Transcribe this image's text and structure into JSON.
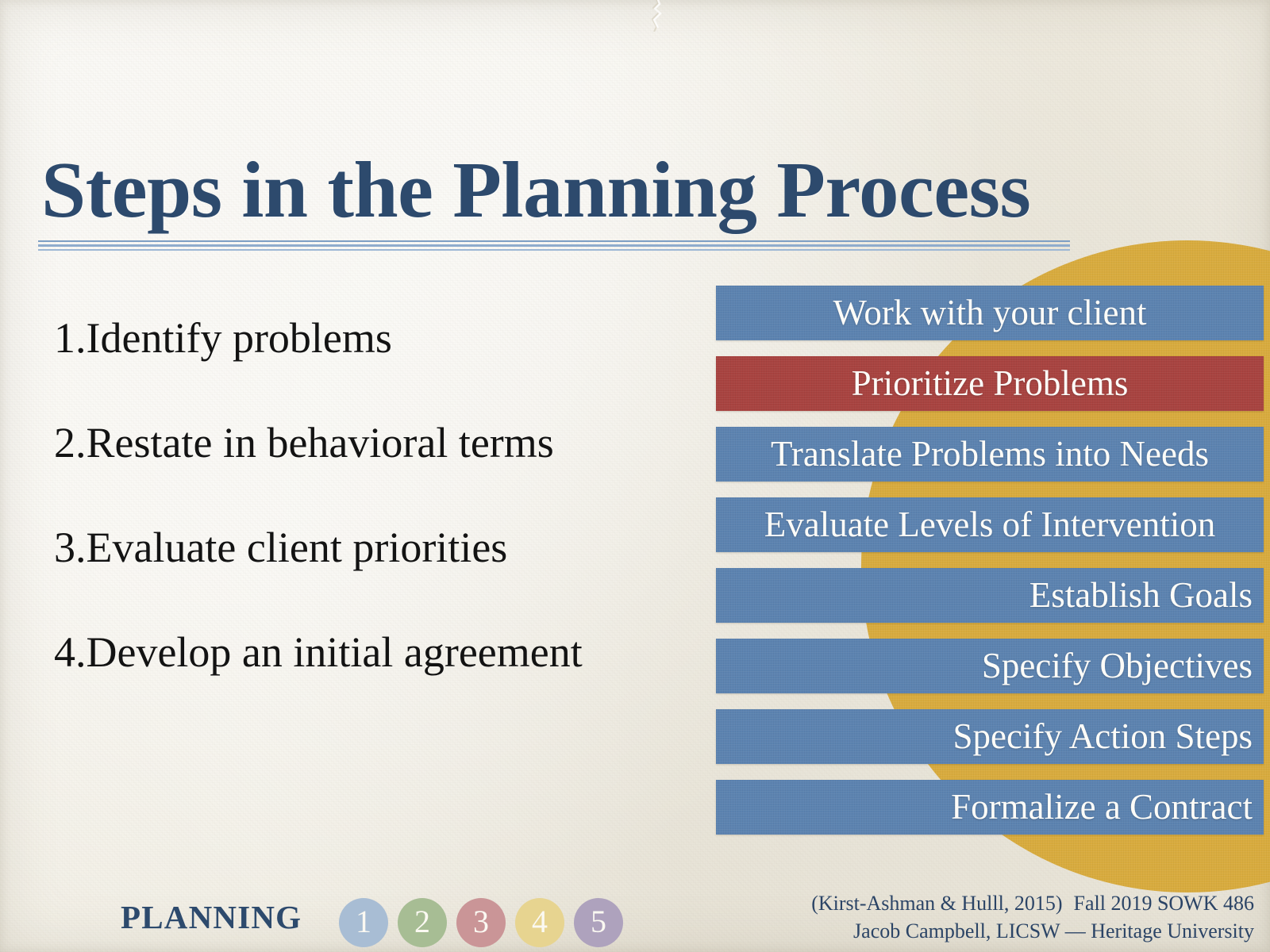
{
  "slide": {
    "title": "Steps in the Planning Process",
    "background_color": "#f3f0e7",
    "title_color": "#2d4a6d",
    "accent_circle_color": "#d8ab3e"
  },
  "steps": [
    {
      "number": "1.",
      "text": "Identify problems"
    },
    {
      "number": "2.",
      "text": "Restate in behavioral terms"
    },
    {
      "number": "3.",
      "text": "Evaluate client priorities"
    },
    {
      "number": "4.",
      "text": "Develop an initial agreement"
    }
  ],
  "process_bars": [
    {
      "label": "Work with your client",
      "color": "#5c83b0",
      "highlight": false,
      "align": "center"
    },
    {
      "label": "Prioritize Problems",
      "color": "#a84340",
      "highlight": true,
      "align": "center"
    },
    {
      "label": "Translate Problems into Needs",
      "color": "#5c83b0",
      "highlight": false,
      "align": "center"
    },
    {
      "label": "Evaluate Levels of Intervention",
      "color": "#5c83b0",
      "highlight": false,
      "align": "center"
    },
    {
      "label": "Establish Goals",
      "color": "#5c83b0",
      "highlight": false,
      "align": "right"
    },
    {
      "label": "Specify Objectives",
      "color": "#5c83b0",
      "highlight": false,
      "align": "right"
    },
    {
      "label": "Specify Action Steps",
      "color": "#5c83b0",
      "highlight": false,
      "align": "right"
    },
    {
      "label": "Formalize a Contract",
      "color": "#5c83b0",
      "highlight": false,
      "align": "right"
    }
  ],
  "footer": {
    "brand": "PLANNING",
    "dots": [
      {
        "number": "1",
        "color": "#a8bdd4"
      },
      {
        "number": "2",
        "color": "#a7bd94"
      },
      {
        "number": "3",
        "color": "#ca9597"
      },
      {
        "number": "4",
        "color": "#e7d490"
      },
      {
        "number": "5",
        "color": "#aea2bd"
      }
    ],
    "citation": "(Kirst-Ashman & Hulll, 2015)",
    "course": "Fall 2019 SOWK 486",
    "presenter": "Jacob Campbell, LICSW — Heritage University"
  }
}
